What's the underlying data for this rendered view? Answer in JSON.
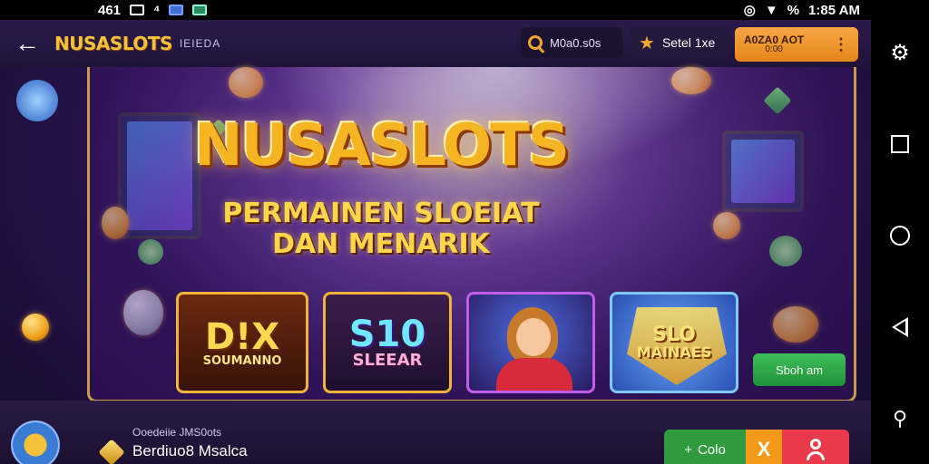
{
  "status_bar": {
    "left_text": "461",
    "time": "1:85 AM",
    "battery": "%"
  },
  "topbar": {
    "back_icon": "arrow-left-icon",
    "brand": "NUSASLOTS",
    "brand_sub": "IEIEDA",
    "search_text": "M0a0.s0s",
    "rating_text": "Setel 1xe",
    "account_main": "A0ZA0 AOT",
    "account_sub": "0:00"
  },
  "banner": {
    "logo": "NUSASLOTS",
    "tagline_line1": "PERMAINEN SLOEIAT",
    "tagline_line2": "DAN MENARIK"
  },
  "games": [
    {
      "title": "D!X",
      "subtitle": "SOUMANNO"
    },
    {
      "title": "S10",
      "subtitle": "SLEEAR"
    },
    {
      "title": "",
      "subtitle": ""
    },
    {
      "title": "SLO",
      "subtitle": "MAINAES"
    }
  ],
  "cta": {
    "label": "Sboh am"
  },
  "bottombar": {
    "sub_text": "Ooedeiie JMS0ots",
    "main_text": "Berdiuo8 Msalca",
    "zoom_label": "Colo",
    "zoom_icon": "plus-icon",
    "x_label": "X"
  },
  "colors": {
    "accent_gold": "#f5b523",
    "cta_green": "#2f9b3e",
    "danger_red": "#e9394b",
    "account_orange": "#f39a1b",
    "bg_purple": "#2a1450"
  }
}
